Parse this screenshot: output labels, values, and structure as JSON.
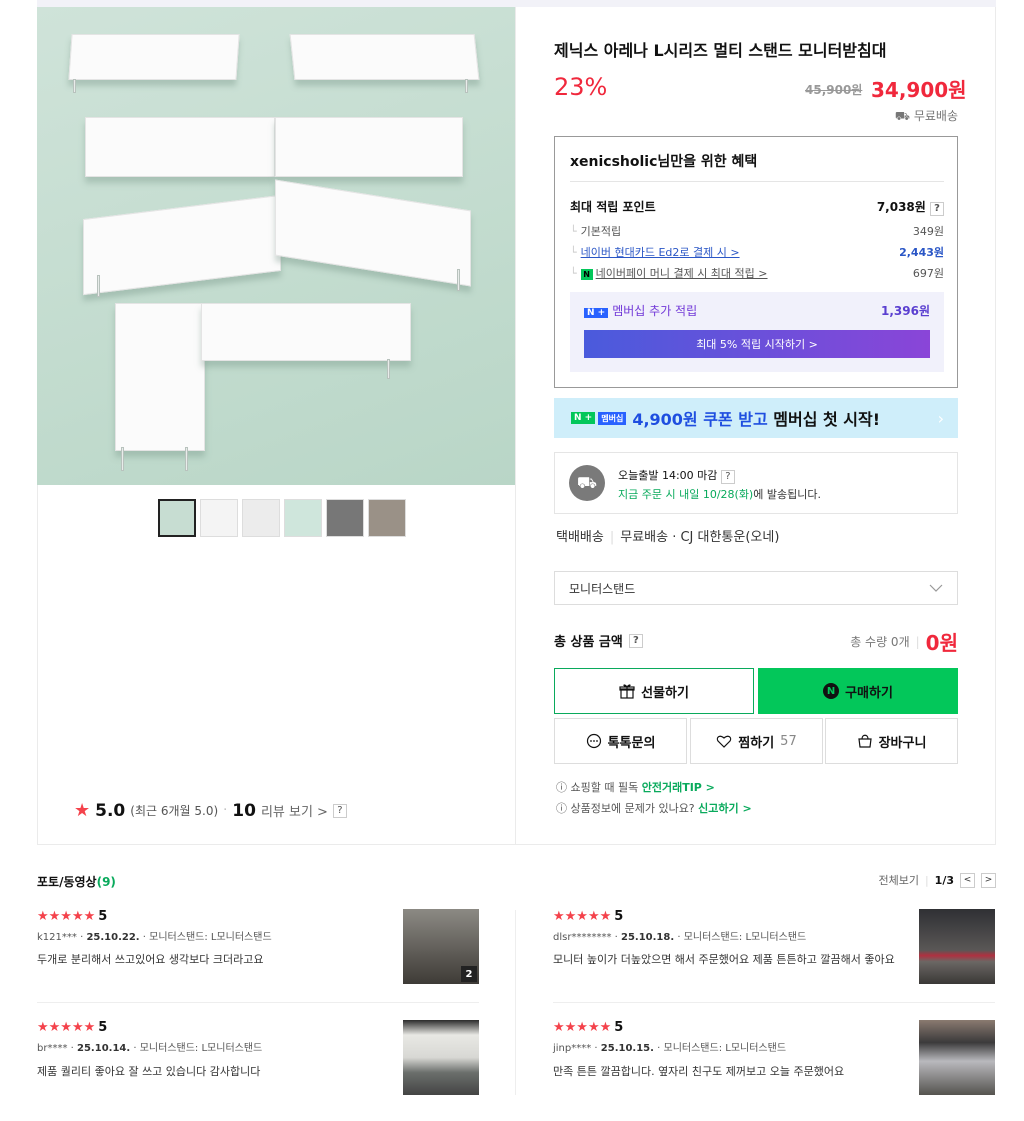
{
  "product": {
    "title": "제닉스 아레나 L시리즈 멀티 스탠드 모니터받침대",
    "discount": "23%",
    "original_price": "45,900원",
    "sale_price": "34,900원",
    "shipping": "무료배송"
  },
  "rating": {
    "score": "5.0",
    "recent": "(최근 6개월 5.0)",
    "count": "10",
    "review_link": "리뷰 보기 >",
    "help": "?"
  },
  "benefit": {
    "title": "xenicsholic님만을 위한 혜택",
    "max_point_label": "최대 적립 포인트",
    "max_point_value": "7,038원",
    "help": "?",
    "rows": [
      {
        "label": "기본적립",
        "value": "349원"
      },
      {
        "label": "네이버 현대카드 Ed2로 결제 시 >",
        "value": "2,443원"
      },
      {
        "label": "네이버페이 머니 결제 시 최대 적립 >",
        "value": "697원"
      }
    ],
    "membership_badge": "N +",
    "membership_label": "멤버십 추가 적립",
    "membership_value": "1,396원",
    "membership_button": "최대 5% 적립 시작하기 >"
  },
  "coupon": {
    "badge_n": "N +",
    "badge_member": "멤버십",
    "highlight": "4,900원 쿠폰 받고",
    "rest": "멤버십 첫 시작!"
  },
  "delivery": {
    "line1": "오늘출발 14:00 마감",
    "help": "?",
    "line2_green": "지금 주문 시 내일 10/28(화)",
    "line2_rest": "에 발송됩니다."
  },
  "shipping_info": {
    "method": "택배배송",
    "detail": "무료배송 · CJ 대한통운(오네)"
  },
  "option_select": {
    "value": "모니터스탠드"
  },
  "total": {
    "label": "총 상품 금액",
    "help": "?",
    "qty": "총 수량 0개",
    "price": "0원"
  },
  "buttons": {
    "gift": "선물하기",
    "buy": "구매하기",
    "talk": "톡톡문의",
    "wish": "찜하기",
    "wish_count": "57",
    "cart": "장바구니"
  },
  "notices": {
    "n1_text": "쇼핑할 때 필독",
    "n1_link": "안전거래TIP >",
    "n2_text": "상품정보에 문제가 있나요?",
    "n2_link": "신고하기 >"
  },
  "reviews": {
    "title": "포토/동영상",
    "count": "(9)",
    "view_all": "전체보기",
    "page": "1/3",
    "prev": "<",
    "next": ">",
    "items": [
      {
        "stars": "★★★★★",
        "score": "5",
        "user": "k121***",
        "date": "25.10.22.",
        "option": "모니터스탠드: L모니터스탠드",
        "text": "두개로 분리해서 쓰고있어요 생각보다 크더라고요",
        "photo_count": "2"
      },
      {
        "stars": "★★★★★",
        "score": "5",
        "user": "dlsr********",
        "date": "25.10.18.",
        "option": "모니터스탠드: L모니터스탠드",
        "text": "모니터 높이가 더높았으면 해서 주문했어요 제품 튼튼하고 깔끔해서 좋아요"
      },
      {
        "stars": "★★★★★",
        "score": "5",
        "user": "br****",
        "date": "25.10.14.",
        "option": "모니터스탠드: L모니터스탠드",
        "text": "제품 퀄리티 좋아요 잘 쓰고 있습니다 감사합니다"
      },
      {
        "stars": "★★★★★",
        "score": "5",
        "user": "jinp****",
        "date": "25.10.15.",
        "option": "모니터스탠드: L모니터스탠드",
        "text": "만족 튼튼 깔끔합니다. 옆자리 친구도 제꺼보고 오늘 주문했어요"
      }
    ]
  },
  "colors": {
    "accent_red": "#f0283c",
    "naver_green": "#03c75a",
    "link_blue": "#2a56c6"
  }
}
